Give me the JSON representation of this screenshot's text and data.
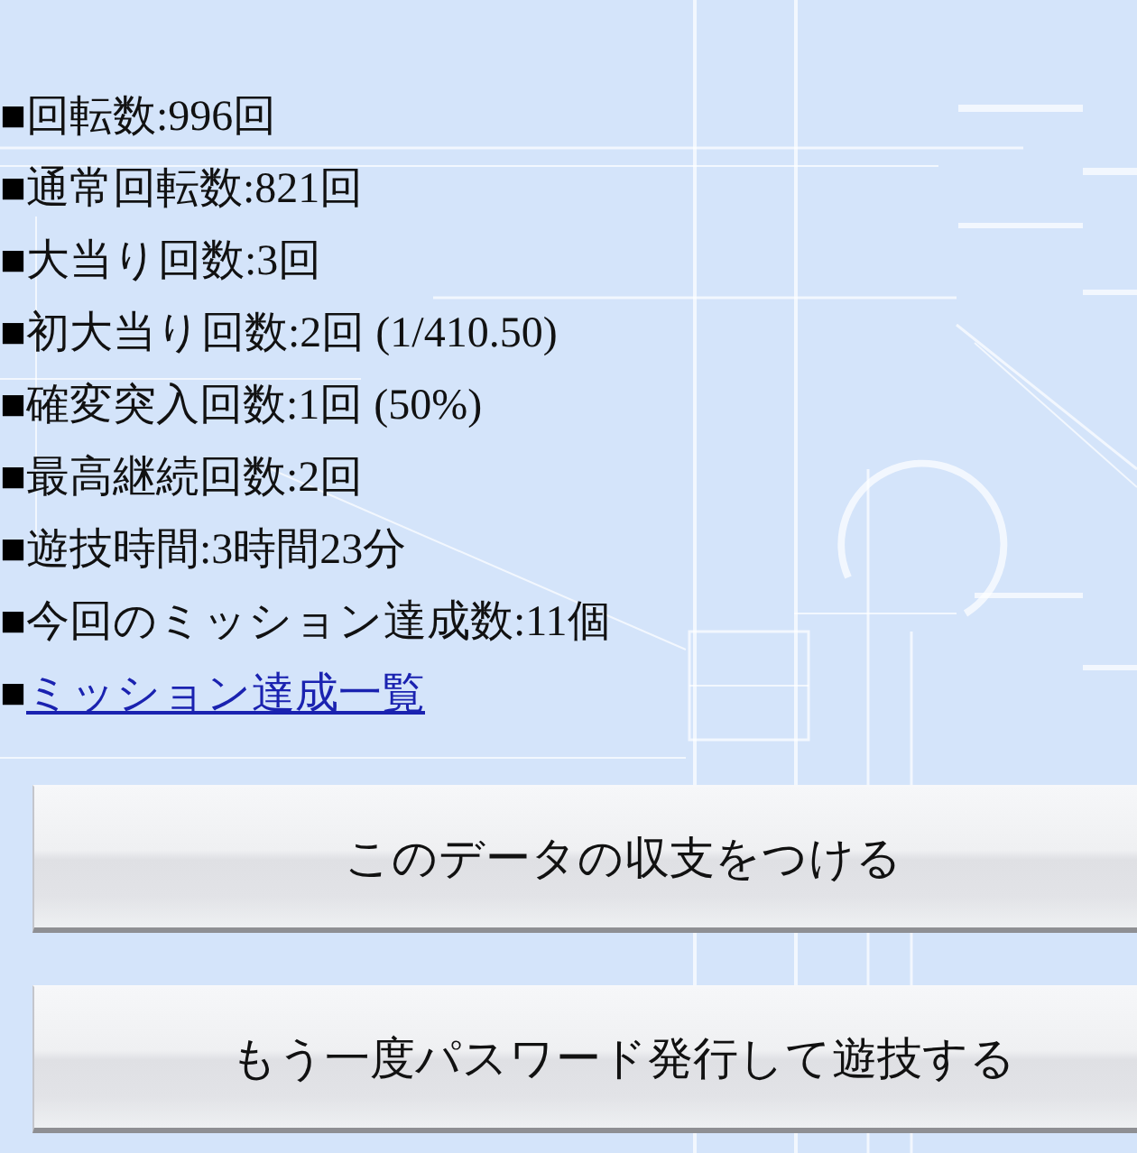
{
  "stats": [
    {
      "kind": "text",
      "marker": "■",
      "text": "回転数:996回"
    },
    {
      "kind": "text",
      "marker": "■",
      "text": "通常回転数:821回"
    },
    {
      "kind": "text",
      "marker": "■",
      "text": "大当り回数:3回"
    },
    {
      "kind": "text",
      "marker": "■",
      "text": "初大当り回数:2回 (1/410.50)"
    },
    {
      "kind": "text",
      "marker": "■",
      "text": "確変突入回数:1回 (50%)"
    },
    {
      "kind": "text",
      "marker": "■",
      "text": "最高継続回数:2回"
    },
    {
      "kind": "text",
      "marker": "■",
      "text": "遊技時間:3時間23分"
    },
    {
      "kind": "text",
      "marker": "■",
      "text": "今回のミッション達成数:11個"
    },
    {
      "kind": "link",
      "marker": "■",
      "text": "ミッション達成一覧"
    }
  ],
  "buttons": [
    {
      "label": "このデータの収支をつける"
    },
    {
      "label": "もう一度パスワード発行して遊技する"
    }
  ]
}
